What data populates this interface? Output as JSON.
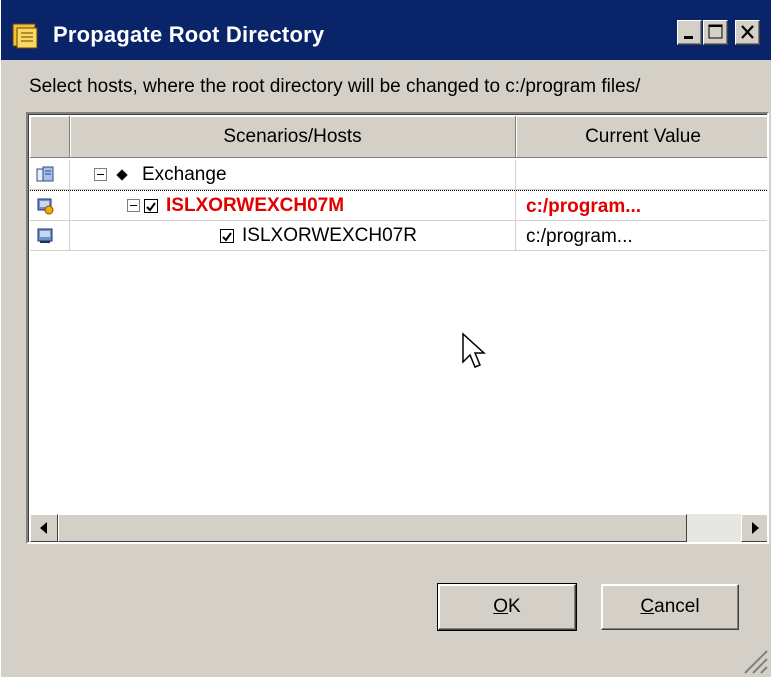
{
  "window": {
    "title": "Propagate Root Directory",
    "controls": [
      "minimize",
      "maximize",
      "close"
    ]
  },
  "prompt": "Select hosts, where the root directory will be changed to c:/program files/",
  "grid": {
    "columns": [
      "Scenarios/Hosts",
      "Current Value"
    ],
    "rows": [
      {
        "level": 0,
        "name": "Exchange",
        "value": "",
        "checked": null,
        "expanded": true,
        "highlight": false,
        "icon": "scenario-icon"
      },
      {
        "level": 1,
        "name": "ISLXORWEXCH07M",
        "value": "c:/program...",
        "checked": true,
        "expanded": true,
        "highlight": true,
        "icon": "master-host-icon"
      },
      {
        "level": 2,
        "name": "ISLXORWEXCH07R",
        "value": "c:/program...",
        "checked": true,
        "expanded": false,
        "highlight": false,
        "icon": "replica-host-icon"
      }
    ]
  },
  "buttons": {
    "ok_accel": "O",
    "ok_rest": "K",
    "cancel_accel": "C",
    "cancel_rest": "ancel"
  },
  "colors": {
    "titlebar": "#0a246a",
    "highlight_text": "#e50000",
    "face": "#d4d0c8"
  }
}
